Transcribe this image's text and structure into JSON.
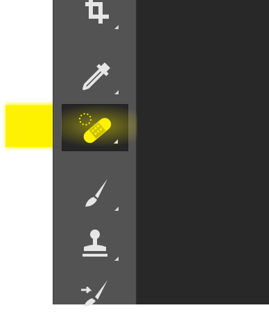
{
  "toolbar": {
    "tools": [
      {
        "name": "crop-tool",
        "icon": "crop-icon"
      },
      {
        "name": "eyedropper-tool",
        "icon": "eyedropper-icon"
      },
      {
        "name": "spot-healing-brush-tool",
        "icon": "healing-bandage-icon",
        "active": true
      },
      {
        "name": "brush-tool",
        "icon": "brush-icon"
      },
      {
        "name": "clone-stamp-tool",
        "icon": "stamp-icon"
      },
      {
        "name": "history-brush-tool",
        "icon": "history-brush-icon"
      }
    ]
  },
  "colors": {
    "toolbar_bg": "#535353",
    "canvas_bg": "#282828",
    "highlight": "#fff200",
    "icon": "#e6e6e6"
  }
}
